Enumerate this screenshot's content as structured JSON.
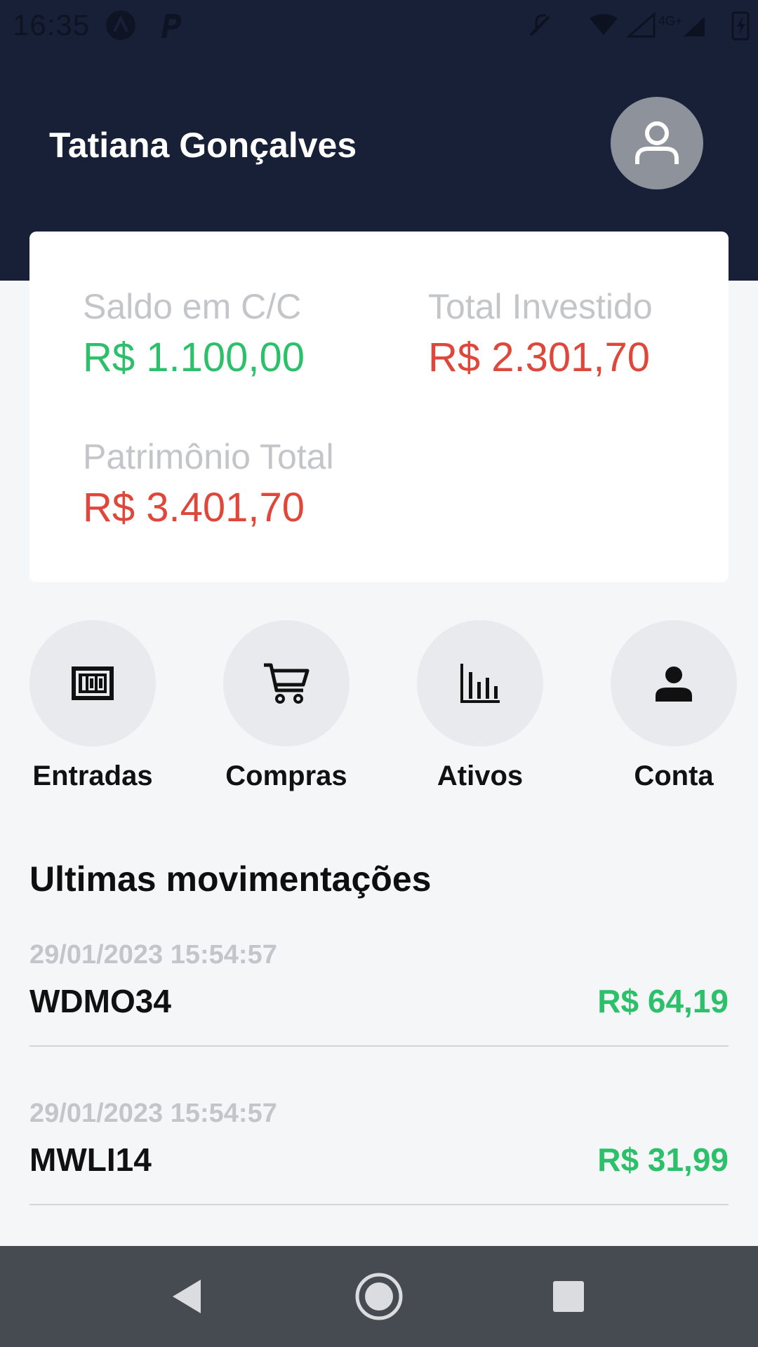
{
  "status_bar": {
    "time": "16:35",
    "network_label": "4G+"
  },
  "header": {
    "user_name": "Tatiana Gonçalves"
  },
  "summary": {
    "balance_label": "Saldo em C/C",
    "balance_value": "R$ 1.100,00",
    "invested_label": "Total Investido",
    "invested_value": "R$ 2.301,70",
    "equity_label": "Patrimônio Total",
    "equity_value": "R$ 3.401,70"
  },
  "actions": [
    {
      "label": "Entradas",
      "icon": "money-icon"
    },
    {
      "label": "Compras",
      "icon": "cart-icon"
    },
    {
      "label": "Ativos",
      "icon": "bar-chart-icon"
    },
    {
      "label": "Conta",
      "icon": "person-icon"
    }
  ],
  "movements": {
    "title": "Ultimas movimentações",
    "items": [
      {
        "date": "29/01/2023 15:54:57",
        "ticker": "WDMO34",
        "amount": "R$ 64,19"
      },
      {
        "date": "29/01/2023 15:54:57",
        "ticker": "MWLI14",
        "amount": "R$ 31,99"
      }
    ]
  },
  "colors": {
    "header_bg": "#172037",
    "positive": "#2DC06A",
    "negative": "#E0473B",
    "nav_bg": "#454B51"
  }
}
